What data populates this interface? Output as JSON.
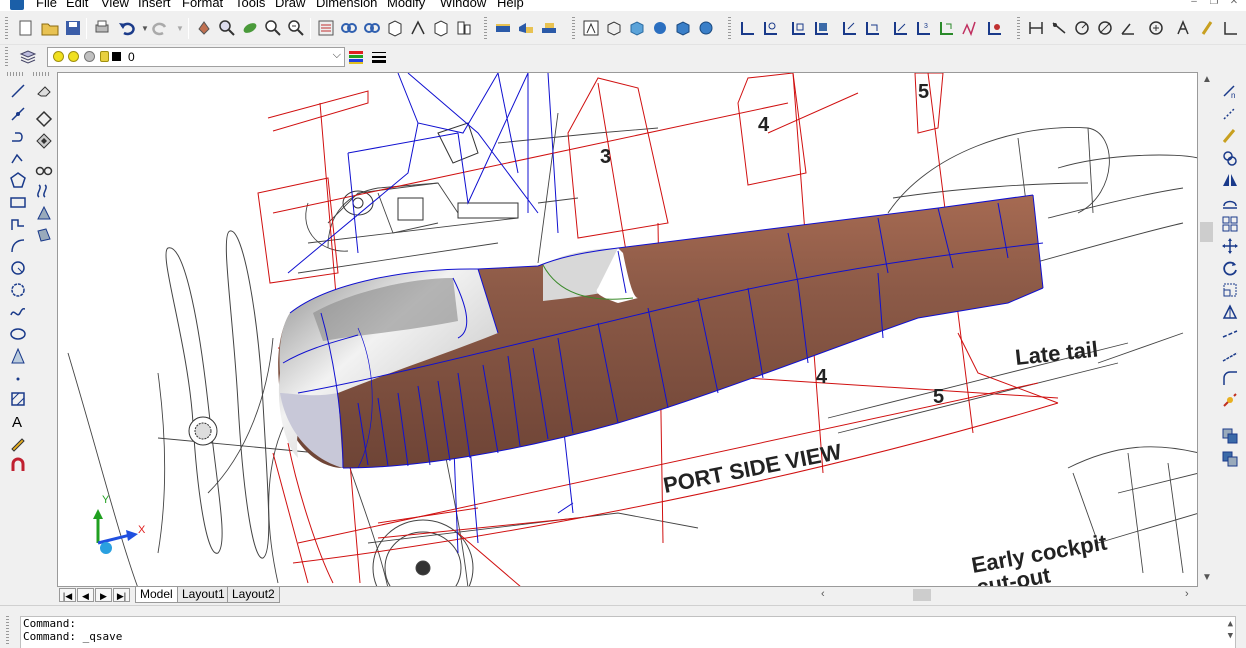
{
  "menu": [
    "File",
    "Edit",
    "View",
    "Insert",
    "Format",
    "Tools",
    "Draw",
    "Dimension",
    "Modify",
    "Window",
    "Help"
  ],
  "layer_toolbar": {
    "current_layer": "0"
  },
  "drawing": {
    "labels": [
      "3",
      "4",
      "5",
      "4",
      "5",
      "Late tail",
      "PORT SIDE VIEW",
      "Early cockpit",
      "cut-out"
    ],
    "ucs": {
      "x": "X",
      "y": "Y"
    }
  },
  "tabs": [
    "Model",
    "Layout1",
    "Layout2"
  ],
  "command_lines": [
    "Command:",
    "Command: _qsave"
  ],
  "colors": {
    "skin": "#8c5a47",
    "wire_blue": "#1010d0",
    "wire_red": "#d01010",
    "metal": "#c4c4c4"
  }
}
